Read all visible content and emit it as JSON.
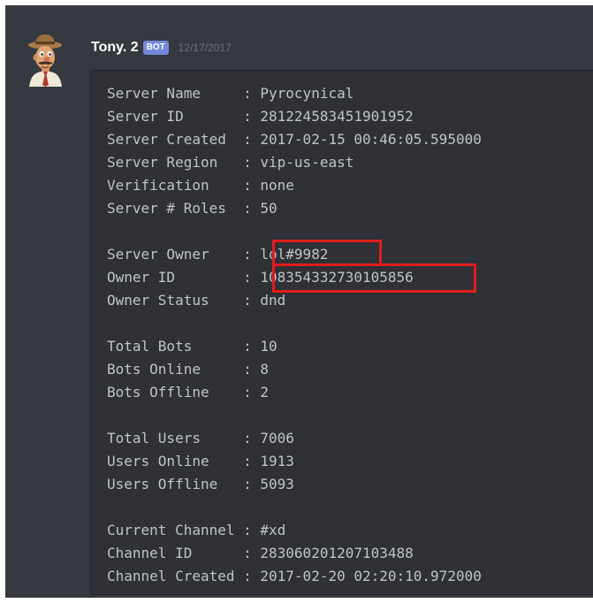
{
  "message": {
    "username": "Tony. 2",
    "bot_tag": "BOT",
    "timestamp": "12/17/2017",
    "avatar_icon": "cartoon-man-with-hat-avatar"
  },
  "code_lines": [
    "Server Name     : Pyrocynical",
    "Server ID       : 281224583451901952",
    "Server Created  : 2017-02-15 00:46:05.595000",
    "Server Region   : vip-us-east",
    "Verification    : none",
    "Server # Roles  : 50",
    "",
    "Server Owner    : lol#9982",
    "Owner ID        : 108354332730105856",
    "Owner Status    : dnd",
    "",
    "Total Bots      : 10",
    "Bots Online     : 8",
    "Bots Offline    : 2",
    "",
    "Total Users     : 7006",
    "Users Online    : 1913",
    "Users Offline   : 5093",
    "",
    "Current Channel : #xd",
    "Channel ID      : 283060201207103488",
    "Channel Created : 2017-02-20 02:20:10.972000"
  ],
  "highlight_color": "#e11d1d",
  "bot_tag_color": "#7289da"
}
